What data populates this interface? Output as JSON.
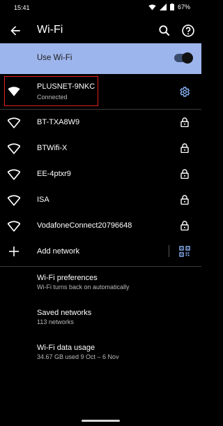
{
  "status_bar": {
    "time": "15:41",
    "battery": "67%"
  },
  "app_bar": {
    "title": "Wi-Fi"
  },
  "wifi_toggle": {
    "label": "Use Wi-Fi",
    "on": true
  },
  "connected_network": {
    "name": "PLUSNET-9NKC",
    "status": "Connected"
  },
  "networks": [
    {
      "name": "BT-TXA8W9",
      "secured": true
    },
    {
      "name": "BTWifi-X",
      "secured": true
    },
    {
      "name": "EE-4ptxr9",
      "secured": true
    },
    {
      "name": "ISA",
      "secured": true
    },
    {
      "name": "VodafoneConnect20796648",
      "secured": true
    }
  ],
  "add_network": {
    "label": "Add network"
  },
  "preferences": [
    {
      "title": "Wi-Fi preferences",
      "subtitle": "Wi-Fi turns back on automatically"
    },
    {
      "title": "Saved networks",
      "subtitle": "113 networks"
    },
    {
      "title": "Wi-Fi data usage",
      "subtitle": "34.67 GB used 9 Oct – 6 Nov"
    }
  ],
  "colors": {
    "accent": "#9db5ed",
    "gear": "#8ab4f8",
    "highlight": "#e02020"
  },
  "icons": [
    "back-arrow-icon",
    "search-icon",
    "help-icon",
    "wifi-icon",
    "gear-icon",
    "lock-icon",
    "plus-icon",
    "qr-code-icon"
  ]
}
